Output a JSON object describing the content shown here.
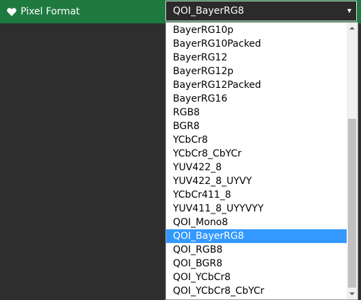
{
  "colors": {
    "header_bg": "#1f7a40",
    "selected_bg": "#3399ff",
    "page_bg": "#2e2e2e"
  },
  "field": {
    "icon": "heart-icon",
    "label": "Pixel Format",
    "value": "QOI_BayerRG8"
  },
  "options": [
    "BayerRG10p",
    "BayerRG10Packed",
    "BayerRG12",
    "BayerRG12p",
    "BayerRG12Packed",
    "BayerRG16",
    "RGB8",
    "BGR8",
    "YCbCr8",
    "YCbCr8_CbYCr",
    "YUV422_8",
    "YUV422_8_UYVY",
    "YCbCr411_8",
    "YUV411_8_UYYVYY",
    "QOI_Mono8",
    "QOI_BayerRG8",
    "QOI_RGB8",
    "QOI_BGR8",
    "QOI_YCbCr8",
    "QOI_YCbCr8_CbYCr"
  ],
  "selected_option": "QOI_BayerRG8"
}
